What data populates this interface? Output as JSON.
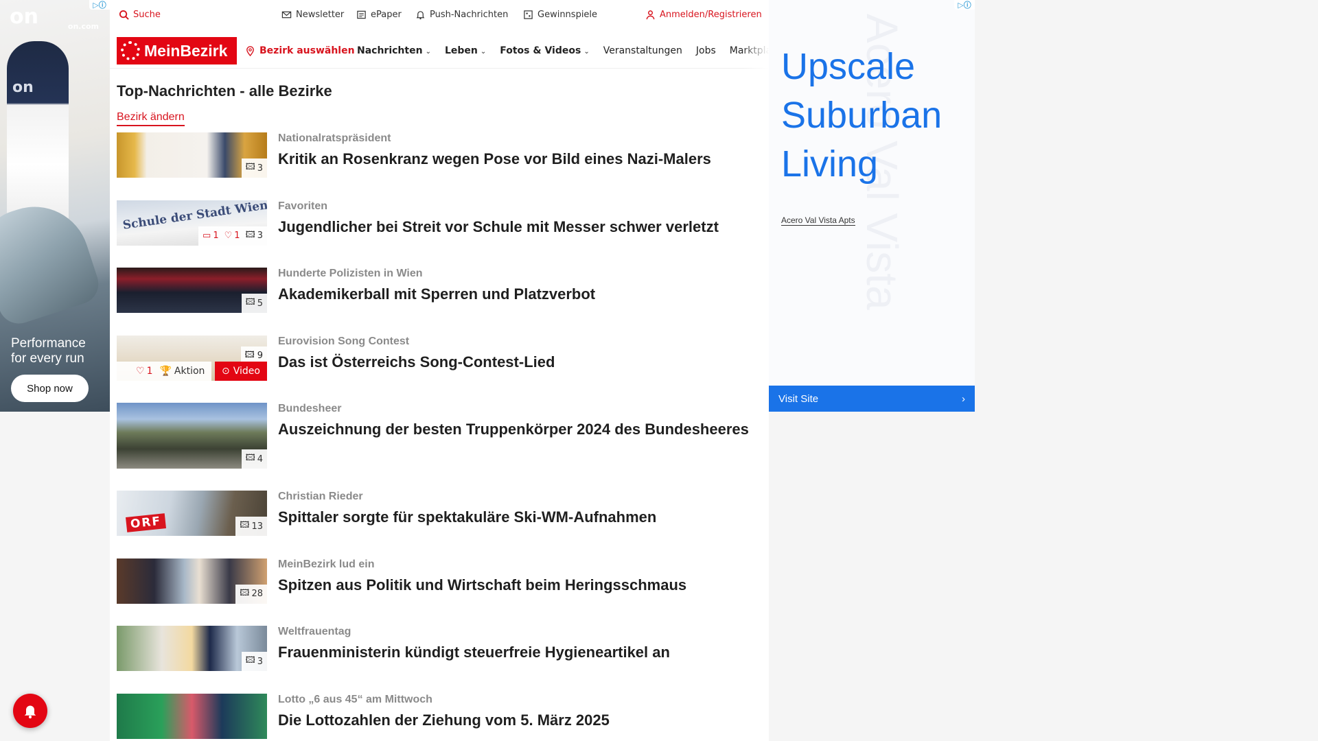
{
  "ad_left": {
    "brand_logo": "on",
    "site": "on.com",
    "tagline_line1": "Performance",
    "tagline_line2": "for every run",
    "cta": "Shop now",
    "adchoices_icon": "adchoices-icon"
  },
  "topbar": {
    "search": "Suche",
    "newsletter": "Newsletter",
    "epaper": "ePaper",
    "push": "Push-Nachrichten",
    "gewinnspiele": "Gewinnspiele",
    "login": "Anmelden/Registrieren"
  },
  "nav": {
    "brand": "MeinBezirk",
    "bezirk": "Bezirk auswählen",
    "links": {
      "nachrichten": "Nachrichten",
      "leben": "Leben",
      "fotos": "Fotos & Videos",
      "veranstaltungen": "Veranstaltungen",
      "jobs": "Jobs",
      "marktplatz": "Marktplatz"
    }
  },
  "section": {
    "title": "Top-Nachrichten - alle Bezirke",
    "change": "Bezirk ändern"
  },
  "articles": [
    {
      "kicker": "Nationalratspräsident",
      "headline": "Kritik an Rosenkranz wegen Pose vor Bild eines Nazi-Malers",
      "photos": "3"
    },
    {
      "kicker": "Favoriten",
      "headline": "Jugendlicher bei Streit vor Schule mit Messer schwer verletzt",
      "comments": "1",
      "likes": "1",
      "photos": "3",
      "sign_text": "Schule der Stadt Wien"
    },
    {
      "kicker": "Hunderte Polizisten in Wien",
      "headline": "Akademikerball mit Sperren und Platzverbot",
      "photos": "5"
    },
    {
      "kicker": "Eurovision Song Contest",
      "headline": "Das ist Österreichs Song-Contest-Lied",
      "photos": "9",
      "likes": "1",
      "action": "Aktion",
      "video": "Video"
    },
    {
      "kicker": "Bundesheer",
      "headline": "Auszeichnung der besten Truppenkörper 2024 des Bundesheeres",
      "photos": "4"
    },
    {
      "kicker": "Christian Rieder",
      "headline": "Spittaler sorgte für spektakuläre Ski-WM-Aufnahmen",
      "photos": "13",
      "sign_text": "ORF"
    },
    {
      "kicker": "MeinBezirk lud ein",
      "headline": "Spitzen aus Politik und Wirtschaft beim Heringsschmaus",
      "photos": "28"
    },
    {
      "kicker": "Weltfrauentag",
      "headline": "Frauenministerin kündigt steuerfreie Hygieneartikel an",
      "photos": "3"
    },
    {
      "kicker": "Lotto „6 aus 45“ am Mittwoch",
      "headline": "Die Lottozahlen der Ziehung vom 5. März 2025"
    }
  ],
  "ad_right": {
    "headline_line1": "Upscale",
    "headline_line2": "Suburban",
    "headline_line3": "Living",
    "advertiser": "Acero Val Vista Apts",
    "background_text": "Acero Val Vista",
    "cta": "Visit Site"
  },
  "colors": {
    "brand_red": "#e30613",
    "ad_blue": "#1a73e8"
  }
}
